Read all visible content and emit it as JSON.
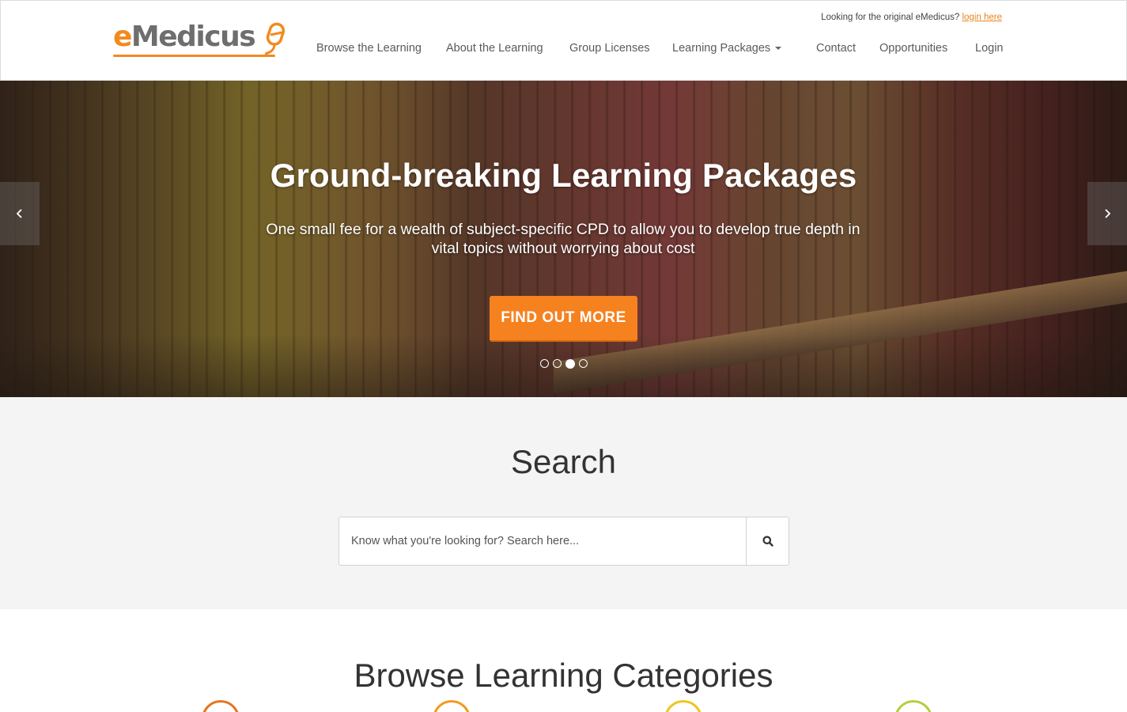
{
  "header": {
    "logo_text_e": "e",
    "logo_text_rest": "Medicus",
    "topnote_text": "Looking for the original eMedicus?",
    "topnote_link": "login here",
    "nav": [
      {
        "label": "Browse the Learning"
      },
      {
        "label": "About the Learning"
      },
      {
        "label": "Group Licenses"
      },
      {
        "label": "Learning Packages"
      },
      {
        "label": "Contact"
      },
      {
        "label": "Opportunities"
      },
      {
        "label": "Login"
      }
    ]
  },
  "hero": {
    "title": "Ground-breaking Learning Packages",
    "subtitle": "One small fee for a wealth of subject-specific CPD to allow you to develop true depth in vital topics without worrying about cost",
    "button_label": "FIND OUT MORE",
    "slides_count": 4,
    "active_slide": 3,
    "prev_icon": "chevron-left-icon",
    "next_icon": "chevron-right-icon"
  },
  "search": {
    "title": "Search",
    "placeholder": "Know what you're looking for? Search here...",
    "button_icon": "search-icon"
  },
  "categories": {
    "title": "Browse Learning Categories",
    "circle_colors": [
      "#e8731e",
      "#f29a1e",
      "#f2c31e",
      "#b5cf3a"
    ]
  },
  "colors": {
    "accent": "#f5821f",
    "link": "#e8831d"
  }
}
